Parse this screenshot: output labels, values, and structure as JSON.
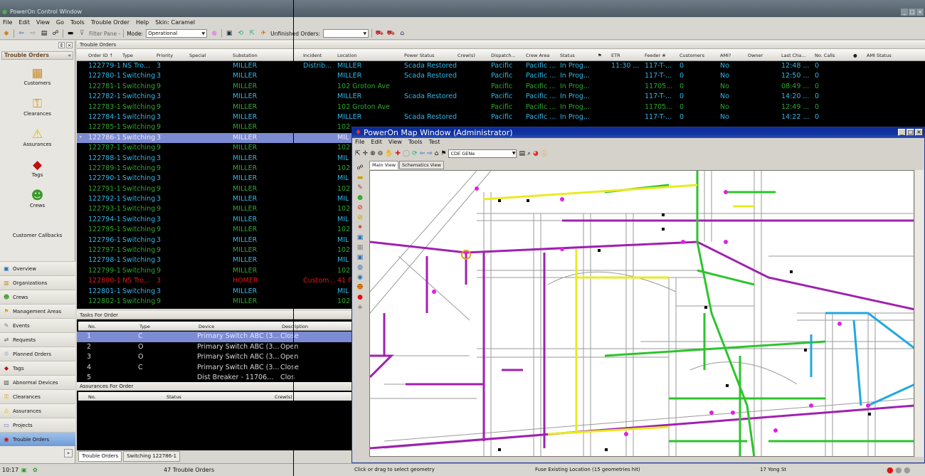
{
  "window": {
    "title": "PowerOn Control Window"
  },
  "menubar": [
    "File",
    "Edit",
    "View",
    "Go",
    "Tools",
    "Trouble Order",
    "Help",
    "Skin: Caramel"
  ],
  "toolbar": {
    "filter_pane": "Filter Pane -",
    "mode_label": "Mode:",
    "mode_value": "Operational",
    "unfinished_label": "Unfinished Orders:",
    "unfinished_value": ""
  },
  "leftnav": {
    "header": "Trouble Orders",
    "big_items": [
      {
        "label": "Customers",
        "icon": "building-icon"
      },
      {
        "label": "Clearances",
        "icon": "key-icon"
      },
      {
        "label": "Assurances",
        "icon": "warning-icon"
      },
      {
        "label": "Tags",
        "icon": "tag-icon"
      },
      {
        "label": "Crews",
        "icon": "crew-icon"
      },
      {
        "label": "Customer Callbacks",
        "icon": ""
      }
    ],
    "list_items": [
      {
        "label": "Overview",
        "icon": "overview-icon"
      },
      {
        "label": "Organizations",
        "icon": "organizations-icon"
      },
      {
        "label": "Crews",
        "icon": "crews-icon"
      },
      {
        "label": "Management Areas",
        "icon": "management-areas-icon"
      },
      {
        "label": "Events",
        "icon": "events-icon"
      },
      {
        "label": "Requests",
        "icon": "requests-icon"
      },
      {
        "label": "Planned Orders",
        "icon": "planned-orders-icon"
      },
      {
        "label": "Tags",
        "icon": "tags-icon"
      },
      {
        "label": "Abnormal Devices",
        "icon": "abnormal-devices-icon"
      },
      {
        "label": "Clearances",
        "icon": "clearances-icon"
      },
      {
        "label": "Assurances",
        "icon": "assurances-icon"
      },
      {
        "label": "Projects",
        "icon": "projects-icon"
      },
      {
        "label": "Trouble Orders",
        "icon": "trouble-orders-icon"
      }
    ]
  },
  "trouble_orders": {
    "panel_title": "Trouble Orders",
    "columns": [
      "Order ID ↑",
      "Type",
      "Priority",
      "Special",
      "Substation",
      "Incident",
      "Location",
      "Power Status",
      "Crew(s)",
      "Dispatch...",
      "Crew Area",
      "Status",
      "",
      "ETR",
      "Feeder #",
      "Customers",
      "AMI?",
      "Owner",
      "Last Cha...",
      "No. Calls",
      "",
      "AMI Status"
    ],
    "rows": [
      {
        "id": "122779-1",
        "type": "NS Tro...",
        "priority": "3",
        "substation": "MILLER",
        "incident": "Distrib...",
        "location": "MILLER",
        "power": "Scada Restored",
        "dispatch": "Pacific",
        "area": "Pacific ...",
        "status": "In Prog...",
        "etr": "11:30 ...",
        "feeder": "117-T-...",
        "customers": "0",
        "ami": "No",
        "last": "12:48 ...",
        "calls": "0",
        "color": "#2fb8ea"
      },
      {
        "id": "122780-1",
        "type": "Switching",
        "priority": "3",
        "substation": "MILLER",
        "incident": "",
        "location": "MILLER",
        "power": "Scada Restored",
        "dispatch": "Pacific",
        "area": "Pacific ...",
        "status": "In Prog...",
        "etr": "",
        "feeder": "117-T-...",
        "customers": "0",
        "ami": "No",
        "last": "12:50 ...",
        "calls": "0",
        "color": "#2fb8ea"
      },
      {
        "id": "122781-1",
        "type": "Switching",
        "priority": "9",
        "substation": "MILLER",
        "incident": "",
        "location": "102 Groton Ave",
        "power": "",
        "dispatch": "Pacific",
        "area": "Pacific ...",
        "status": "In Prog...",
        "etr": "",
        "feeder": "11705...",
        "customers": "0",
        "ami": "No",
        "last": "08:49 ...",
        "calls": "0",
        "color": "#2fa82f"
      },
      {
        "id": "122782-1",
        "type": "Switching",
        "priority": "3",
        "substation": "MILLER",
        "incident": "",
        "location": "MILLER",
        "power": "Scada Restored",
        "dispatch": "Pacific",
        "area": "Pacific ...",
        "status": "In Prog...",
        "etr": "",
        "feeder": "117-T-...",
        "customers": "0",
        "ami": "No",
        "last": "14:20 ...",
        "calls": "0",
        "color": "#2fb8ea"
      },
      {
        "id": "122783-1",
        "type": "Switching",
        "priority": "9",
        "substation": "MILLER",
        "incident": "",
        "location": "102 Groton Ave",
        "power": "",
        "dispatch": "Pacific",
        "area": "Pacific ...",
        "status": "In Prog...",
        "etr": "",
        "feeder": "11705...",
        "customers": "0",
        "ami": "No",
        "last": "12:49 ...",
        "calls": "0",
        "color": "#2fa82f"
      },
      {
        "id": "122784-1",
        "type": "Switching",
        "priority": "3",
        "substation": "MILLER",
        "incident": "",
        "location": "MILLER",
        "power": "Scada Restored",
        "dispatch": "Pacific",
        "area": "Pacific ...",
        "status": "In Prog...",
        "etr": "",
        "feeder": "117-T-...",
        "customers": "0",
        "ami": "No",
        "last": "14:22 ...",
        "calls": "0",
        "color": "#2fb8ea"
      },
      {
        "id": "122785-1",
        "type": "Switching",
        "priority": "9",
        "substation": "MILLER",
        "incident": "",
        "location": "102",
        "power": "",
        "dispatch": "",
        "area": "",
        "status": "",
        "etr": "",
        "feeder": "",
        "customers": "",
        "ami": "",
        "last": "",
        "calls": "",
        "color": "#2fa82f"
      },
      {
        "id": "122786-1",
        "type": "Switching",
        "priority": "3",
        "substation": "MILLER",
        "incident": "",
        "location": "MIL",
        "power": "",
        "dispatch": "",
        "area": "",
        "status": "",
        "etr": "",
        "feeder": "",
        "customers": "",
        "ami": "",
        "last": "",
        "calls": "",
        "color": "#e6ecff",
        "selected": true
      },
      {
        "id": "122787-1",
        "type": "Switching",
        "priority": "9",
        "substation": "MILLER",
        "incident": "",
        "location": "102",
        "power": "",
        "dispatch": "",
        "area": "",
        "status": "",
        "etr": "",
        "feeder": "",
        "customers": "",
        "ami": "",
        "last": "",
        "calls": "",
        "color": "#2fa82f"
      },
      {
        "id": "122788-1",
        "type": "Switching",
        "priority": "3",
        "substation": "MILLER",
        "incident": "",
        "location": "MIL",
        "power": "",
        "dispatch": "",
        "area": "",
        "status": "",
        "etr": "",
        "feeder": "",
        "customers": "",
        "ami": "",
        "last": "",
        "calls": "",
        "color": "#2fb8ea"
      },
      {
        "id": "122789-1",
        "type": "Switching",
        "priority": "9",
        "substation": "MILLER",
        "incident": "",
        "location": "102",
        "power": "",
        "dispatch": "",
        "area": "",
        "status": "",
        "etr": "",
        "feeder": "",
        "customers": "",
        "ami": "",
        "last": "",
        "calls": "",
        "color": "#2fa82f"
      },
      {
        "id": "122790-1",
        "type": "Switching",
        "priority": "3",
        "substation": "MILLER",
        "incident": "",
        "location": "MIL",
        "power": "",
        "dispatch": "",
        "area": "",
        "status": "",
        "etr": "",
        "feeder": "",
        "customers": "",
        "ami": "",
        "last": "",
        "calls": "",
        "color": "#2fb8ea"
      },
      {
        "id": "122791-1",
        "type": "Switching",
        "priority": "9",
        "substation": "MILLER",
        "incident": "",
        "location": "102",
        "power": "",
        "dispatch": "",
        "area": "",
        "status": "",
        "etr": "",
        "feeder": "",
        "customers": "",
        "ami": "",
        "last": "",
        "calls": "",
        "color": "#2fa82f"
      },
      {
        "id": "122792-1",
        "type": "Switching",
        "priority": "3",
        "substation": "MILLER",
        "incident": "",
        "location": "MIL",
        "power": "",
        "dispatch": "",
        "area": "",
        "status": "",
        "etr": "",
        "feeder": "",
        "customers": "",
        "ami": "",
        "last": "",
        "calls": "",
        "color": "#2fb8ea"
      },
      {
        "id": "122793-1",
        "type": "Switching",
        "priority": "9",
        "substation": "MILLER",
        "incident": "",
        "location": "102",
        "power": "",
        "dispatch": "",
        "area": "",
        "status": "",
        "etr": "",
        "feeder": "",
        "customers": "",
        "ami": "",
        "last": "",
        "calls": "",
        "color": "#2fa82f"
      },
      {
        "id": "122794-1",
        "type": "Switching",
        "priority": "3",
        "substation": "MILLER",
        "incident": "",
        "location": "MIL",
        "power": "",
        "dispatch": "",
        "area": "",
        "status": "",
        "etr": "",
        "feeder": "",
        "customers": "",
        "ami": "",
        "last": "",
        "calls": "",
        "color": "#2fb8ea"
      },
      {
        "id": "122795-1",
        "type": "Switching",
        "priority": "9",
        "substation": "MILLER",
        "incident": "",
        "location": "102",
        "power": "",
        "dispatch": "",
        "area": "",
        "status": "",
        "etr": "",
        "feeder": "",
        "customers": "",
        "ami": "",
        "last": "",
        "calls": "",
        "color": "#2fa82f"
      },
      {
        "id": "122796-1",
        "type": "Switching",
        "priority": "3",
        "substation": "MILLER",
        "incident": "",
        "location": "MIL",
        "power": "",
        "dispatch": "",
        "area": "",
        "status": "",
        "etr": "",
        "feeder": "",
        "customers": "",
        "ami": "",
        "last": "",
        "calls": "",
        "color": "#2fb8ea"
      },
      {
        "id": "122797-1",
        "type": "Switching",
        "priority": "9",
        "substation": "MILLER",
        "incident": "",
        "location": "102",
        "power": "",
        "dispatch": "",
        "area": "",
        "status": "",
        "etr": "",
        "feeder": "",
        "customers": "",
        "ami": "",
        "last": "",
        "calls": "",
        "color": "#2fa82f"
      },
      {
        "id": "122798-1",
        "type": "Switching",
        "priority": "3",
        "substation": "MILLER",
        "incident": "",
        "location": "MIL",
        "power": "",
        "dispatch": "",
        "area": "",
        "status": "",
        "etr": "",
        "feeder": "",
        "customers": "",
        "ami": "",
        "last": "",
        "calls": "",
        "color": "#2fb8ea"
      },
      {
        "id": "122799-1",
        "type": "Switching",
        "priority": "9",
        "substation": "MILLER",
        "incident": "",
        "location": "102",
        "power": "",
        "dispatch": "",
        "area": "",
        "status": "",
        "etr": "",
        "feeder": "",
        "customers": "",
        "ami": "",
        "last": "",
        "calls": "",
        "color": "#2fa82f"
      },
      {
        "id": "122800-1",
        "type": "NS Tro...",
        "priority": "3",
        "substation": "HOMER",
        "incident": "Custom...",
        "location": "41 F",
        "power": "",
        "dispatch": "",
        "area": "",
        "status": "",
        "etr": "",
        "feeder": "",
        "customers": "",
        "ami": "",
        "last": "",
        "calls": "",
        "color": "#e01818"
      },
      {
        "id": "122801-1",
        "type": "Switching",
        "priority": "3",
        "substation": "MILLER",
        "incident": "",
        "location": "MIL",
        "power": "",
        "dispatch": "",
        "area": "",
        "status": "",
        "etr": "",
        "feeder": "",
        "customers": "",
        "ami": "",
        "last": "",
        "calls": "",
        "color": "#2fb8ea"
      },
      {
        "id": "122802-1",
        "type": "Switching",
        "priority": "9",
        "substation": "MILLER",
        "incident": "",
        "location": "102",
        "power": "",
        "dispatch": "",
        "area": "",
        "status": "",
        "etr": "",
        "feeder": "",
        "customers": "",
        "ami": "",
        "last": "",
        "calls": "",
        "color": "#2fa82f"
      }
    ]
  },
  "tasks": {
    "title": "Tasks For Order",
    "columns": [
      "No.",
      "Type",
      "Device",
      "Description"
    ],
    "rows": [
      {
        "no": "1",
        "type": "C",
        "device": "Primary Switch ABC (3...",
        "desc": "Close",
        "selected": true
      },
      {
        "no": "2",
        "type": "O",
        "device": "Primary Switch ABC (3...",
        "desc": "Open"
      },
      {
        "no": "3",
        "type": "O",
        "device": "Primary Switch ABC (3...",
        "desc": "Open"
      },
      {
        "no": "4",
        "type": "C",
        "device": "Primary Switch ABC (3...",
        "desc": "Close"
      },
      {
        "no": "5",
        "type": "",
        "device": "Dist Breaker - 11706...",
        "desc": "Clos"
      }
    ]
  },
  "assurances": {
    "title": "Assurances For Order",
    "columns": [
      "No.",
      "Status",
      "Crew(s)"
    ]
  },
  "bottom_tabs": [
    "Trouble Orders",
    "Switching 122786-1"
  ],
  "statusbar": {
    "time": "10:17",
    "count": "47 Trouble Orders",
    "hint": "Click or drag to select geometry",
    "fuse": "Fuse Existing Location (15 geometries hit)",
    "street": "17 Yong St"
  },
  "mapwindow": {
    "title": "PowerOn Map Window (Administrator)",
    "menu": [
      "File",
      "Edit",
      "View",
      "Tools",
      "Test"
    ],
    "layer_select": "CDE GENe",
    "tabs": [
      "Main View",
      "Schematics View"
    ]
  }
}
